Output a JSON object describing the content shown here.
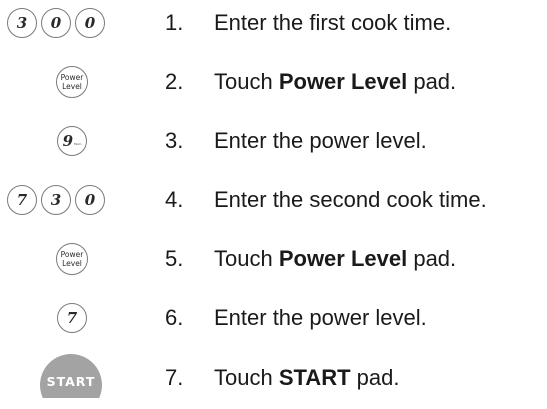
{
  "steps": [
    {
      "num": "1.",
      "keys": [
        "3",
        "0",
        "0"
      ],
      "text": "Enter the first cook time."
    },
    {
      "num": "2.",
      "key_power": {
        "line1": "Power",
        "line2": "Level"
      },
      "pre": "Touch ",
      "bold": "Power Level",
      "post": " pad."
    },
    {
      "num": "3.",
      "key": "9",
      "key_sub": "Mom",
      "text": "Enter the power level."
    },
    {
      "num": "4.",
      "keys": [
        "7",
        "3",
        "0"
      ],
      "text": "Enter the second cook time."
    },
    {
      "num": "5.",
      "key_power": {
        "line1": "Power",
        "line2": "Level"
      },
      "pre": "Touch ",
      "bold": "Power Level",
      "post": " pad."
    },
    {
      "num": "6.",
      "key": "7",
      "text": "Enter the power level."
    },
    {
      "num": "7.",
      "start_label": "START",
      "pre": "Touch ",
      "bold": "START",
      "post": " pad."
    }
  ],
  "colors": {
    "start_button": "#a3a3a3",
    "key_border": "#7a7a7a",
    "text": "#1a1a1a"
  }
}
